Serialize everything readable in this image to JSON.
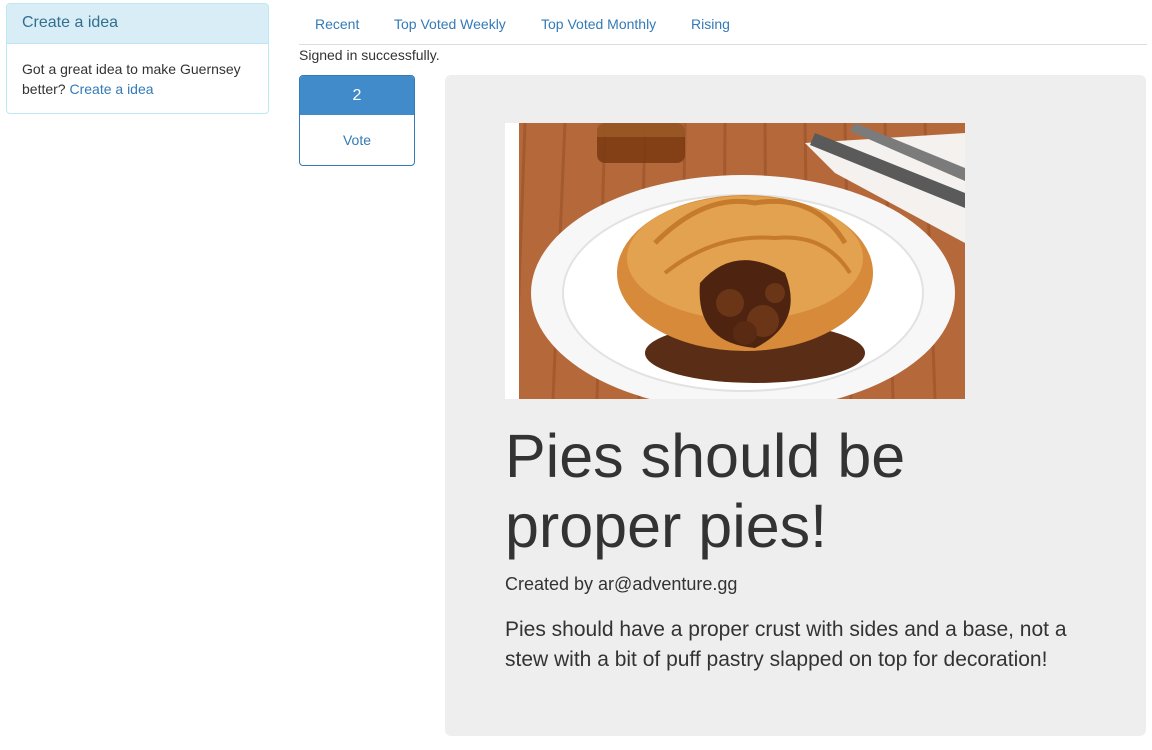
{
  "sidebar": {
    "heading": "Create a idea",
    "body_text": "Got a great idea to make Guernsey better?",
    "link_label": "Create a idea"
  },
  "tabs": [
    {
      "label": "Recent"
    },
    {
      "label": "Top Voted Weekly"
    },
    {
      "label": "Top Voted Monthly"
    },
    {
      "label": "Rising"
    }
  ],
  "flash_message": "Signed in successfully.",
  "vote": {
    "count": "2",
    "button_label": "Vote"
  },
  "idea": {
    "image_alt": "steak pie on a plate",
    "title": "Pies should be proper pies!",
    "author": "Created by ar@adventure.gg",
    "description": "Pies should have a proper crust with sides and a base, not a stew with a bit of puff pastry slapped on top for decoration!"
  },
  "colors": {
    "link": "#337ab7",
    "panel_heading_bg": "#d9edf7",
    "vote_count_bg": "#428bca",
    "card_bg": "#eeeeee"
  }
}
